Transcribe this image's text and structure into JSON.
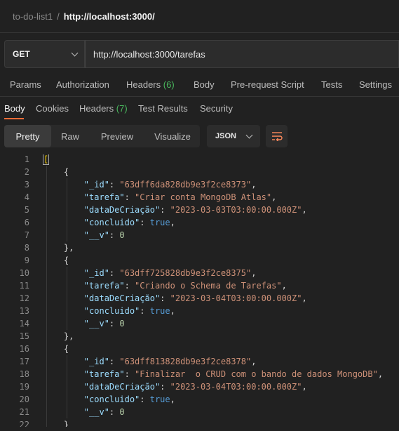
{
  "breadcrumb": {
    "collection": "to-do-list1",
    "separator": "/",
    "request": "http://localhost:3000/"
  },
  "request": {
    "method": "GET",
    "url": "http://localhost:3000/tarefas"
  },
  "request_tabs": [
    {
      "label": "Params"
    },
    {
      "label": "Authorization"
    },
    {
      "label": "Headers",
      "count": "(6)"
    },
    {
      "label": "Body"
    },
    {
      "label": "Pre-request Script"
    },
    {
      "label": "Tests"
    },
    {
      "label": "Settings"
    }
  ],
  "response_tabs": [
    {
      "label": "Body",
      "active": true
    },
    {
      "label": "Cookies"
    },
    {
      "label": "Headers",
      "count": "(7)"
    },
    {
      "label": "Test Results"
    },
    {
      "label": "Security"
    }
  ],
  "view_modes": [
    {
      "label": "Pretty",
      "active": true
    },
    {
      "label": "Raw"
    },
    {
      "label": "Preview"
    },
    {
      "label": "Visualize"
    }
  ],
  "format": "JSON",
  "icons": {
    "method_dropdown": "chevron-down-icon",
    "format_dropdown": "chevron-down-icon",
    "wrap": "wrap-lines-icon"
  },
  "colors": {
    "accent": "#ff6c37",
    "count_green": "#49b85d",
    "json_key": "#9cdcfe",
    "json_string": "#ce9178",
    "json_bool": "#569cd6",
    "json_number": "#b5cea8"
  },
  "response_body": [
    {
      "_id": "63dff6da828db9e3f2ce8373",
      "tarefa": "Criar conta MongoDB Atlas",
      "dataDeCriação": "2023-03-03T03:00:00.000Z",
      "concluido": "true",
      "__v": "0"
    },
    {
      "_id": "63dff725828db9e3f2ce8375",
      "tarefa": "Criando o Schema de Tarefas",
      "dataDeCriação": "2023-03-04T03:00:00.000Z",
      "concluido": "true",
      "__v": "0"
    },
    {
      "_id": "63dff813828db9e3f2ce8378",
      "tarefa": "Finalizar  o CRUD com o bando de dados MongoDB",
      "dataDeCriação": "2023-03-04T03:00:00.000Z",
      "concluido": "true",
      "__v": "0"
    }
  ]
}
